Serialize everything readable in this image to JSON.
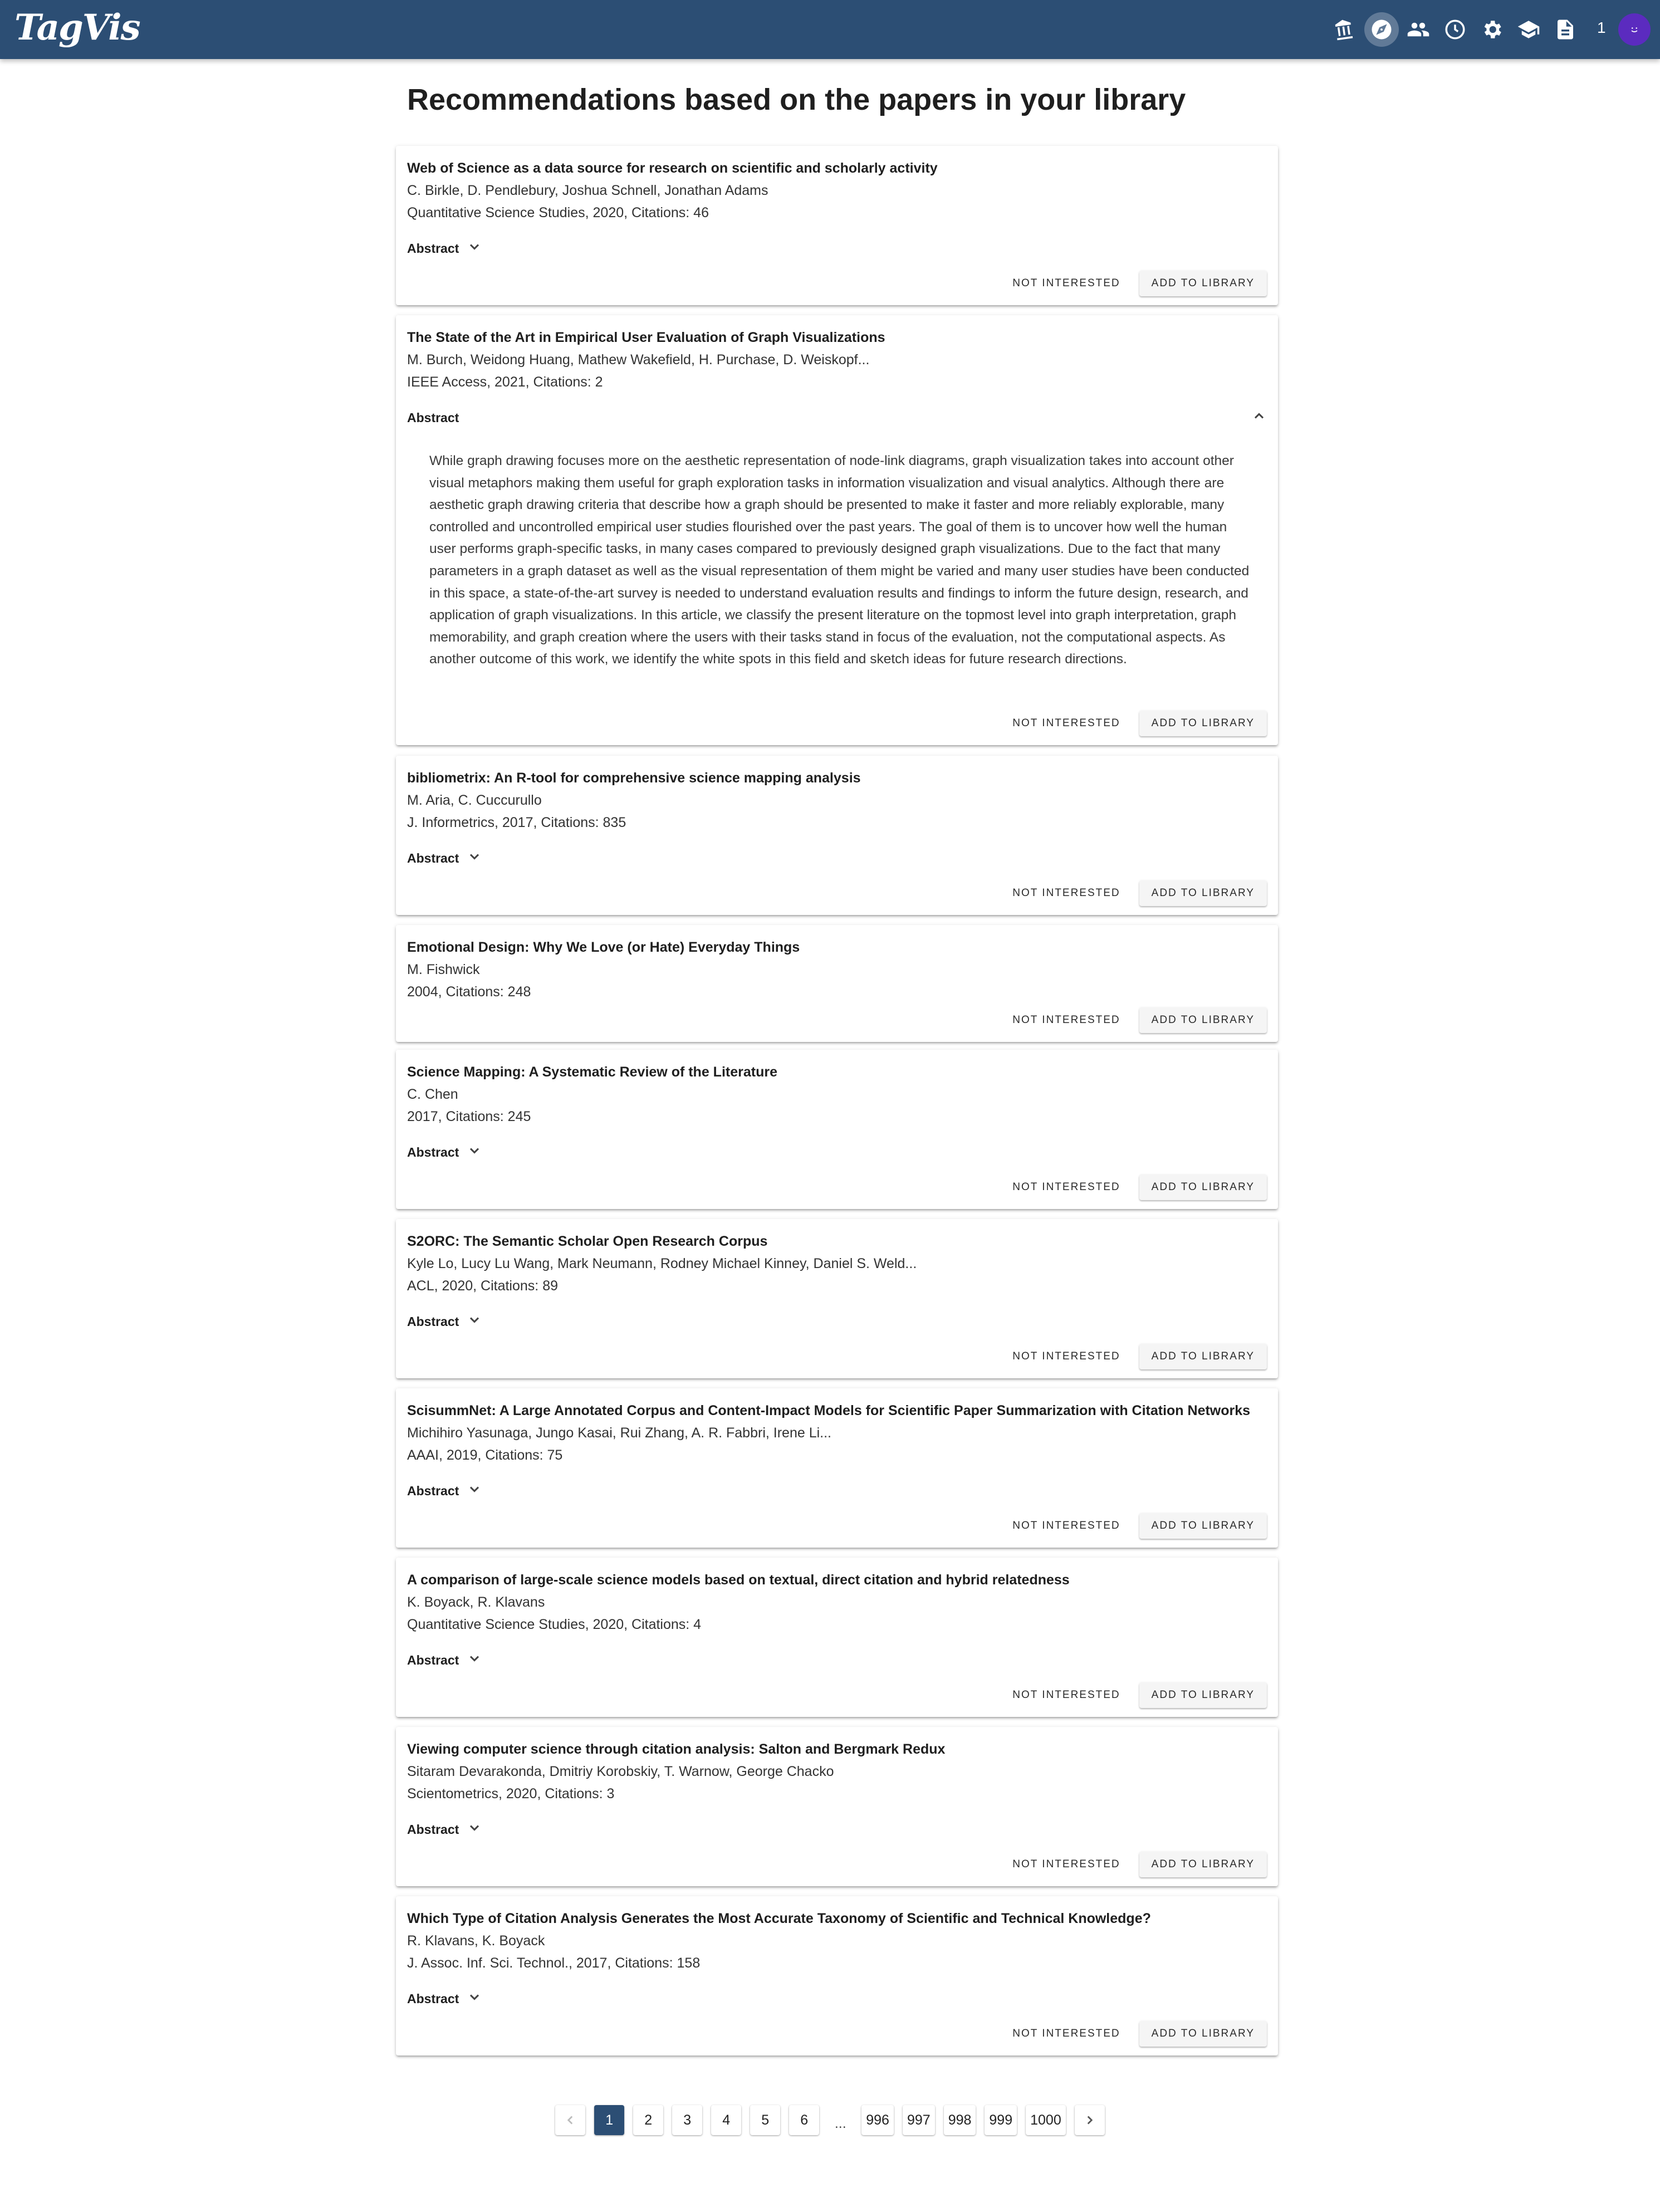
{
  "app": {
    "logo": "TagVis",
    "notification_count": "1"
  },
  "nav": {
    "icons": [
      "library-icon",
      "explore-icon",
      "people-icon",
      "history-icon",
      "settings-icon",
      "school-icon",
      "document-icon"
    ],
    "active": "explore-icon",
    "accent": "#2c4e74",
    "avatar_color": "#5b2bbf"
  },
  "page": {
    "title": "Recommendations based on the papers in your library"
  },
  "labels": {
    "abstract": "Abstract",
    "not_interested": "NOT INTERESTED",
    "add_to_library": "ADD TO LIBRARY"
  },
  "papers": [
    {
      "title": "Web of Science as a data source for research on scientific and scholarly activity",
      "authors": "C. Birkle, D. Pendlebury, Joshua Schnell, Jonathan Adams",
      "venue": "Quantitative Science Studies, 2020, Citations: 46",
      "has_abstract": true,
      "expanded": false
    },
    {
      "title": "The State of the Art in Empirical User Evaluation of Graph Visualizations",
      "authors": "M. Burch, Weidong Huang, Mathew Wakefield, H. Purchase, D. Weiskopf...",
      "venue": "IEEE Access, 2021, Citations: 2",
      "has_abstract": true,
      "expanded": true,
      "abstract_text": "While graph drawing focuses more on the aesthetic representation of node-link diagrams, graph visualization takes into account other visual metaphors making them useful for graph exploration tasks in information visualization and visual analytics. Although there are aesthetic graph drawing criteria that describe how a graph should be presented to make it faster and more reliably explorable, many controlled and uncontrolled empirical user studies flourished over the past years. The goal of them is to uncover how well the human user performs graph-specific tasks, in many cases compared to previously designed graph visualizations. Due to the fact that many parameters in a graph dataset as well as the visual representation of them might be varied and many user studies have been conducted in this space, a state-of-the-art survey is needed to understand evaluation results and findings to inform the future design, research, and application of graph visualizations. In this article, we classify the present literature on the topmost level into graph interpretation, graph memorability, and graph creation where the users with their tasks stand in focus of the evaluation, not the computational aspects. As another outcome of this work, we identify the white spots in this field and sketch ideas for future research directions."
    },
    {
      "title": "bibliometrix: An R-tool for comprehensive science mapping analysis",
      "authors": "M. Aria, C. Cuccurullo",
      "venue": "J. Informetrics, 2017, Citations: 835",
      "has_abstract": true,
      "expanded": false
    },
    {
      "title": "Emotional Design: Why We Love (or Hate) Everyday Things",
      "authors": "M. Fishwick",
      "venue": "2004, Citations: 248",
      "has_abstract": false,
      "expanded": false
    },
    {
      "title": "Science Mapping: A Systematic Review of the Literature",
      "authors": "C. Chen",
      "venue": "2017, Citations: 245",
      "has_abstract": true,
      "expanded": false
    },
    {
      "title": "S2ORC: The Semantic Scholar Open Research Corpus",
      "authors": "Kyle Lo, Lucy Lu Wang, Mark Neumann, Rodney Michael Kinney, Daniel S. Weld...",
      "venue": "ACL, 2020, Citations: 89",
      "has_abstract": true,
      "expanded": false
    },
    {
      "title": "ScisummNet: A Large Annotated Corpus and Content-Impact Models for Scientific Paper Summarization with Citation Networks",
      "authors": "Michihiro Yasunaga, Jungo Kasai, Rui Zhang, A. R. Fabbri, Irene Li...",
      "venue": "AAAI, 2019, Citations: 75",
      "has_abstract": true,
      "expanded": false
    },
    {
      "title": "A comparison of large-scale science models based on textual, direct citation and hybrid relatedness",
      "authors": "K. Boyack, R. Klavans",
      "venue": "Quantitative Science Studies, 2020, Citations: 4",
      "has_abstract": true,
      "expanded": false
    },
    {
      "title": "Viewing computer science through citation analysis: Salton and Bergmark Redux",
      "authors": "Sitaram Devarakonda, Dmitriy Korobskiy, T. Warnow, George Chacko",
      "venue": "Scientometrics, 2020, Citations: 3",
      "has_abstract": true,
      "expanded": false
    },
    {
      "title": "Which Type of Citation Analysis Generates the Most Accurate Taxonomy of Scientific and Technical Knowledge?",
      "authors": "R. Klavans, K. Boyack",
      "venue": "J. Assoc. Inf. Sci. Technol., 2017, Citations: 158",
      "has_abstract": true,
      "expanded": false
    }
  ],
  "pagination": {
    "current": "1",
    "first_pages": [
      "1",
      "2",
      "3",
      "4",
      "5",
      "6"
    ],
    "ellipsis": "...",
    "last_pages": [
      "996",
      "997",
      "998",
      "999",
      "1000"
    ]
  }
}
